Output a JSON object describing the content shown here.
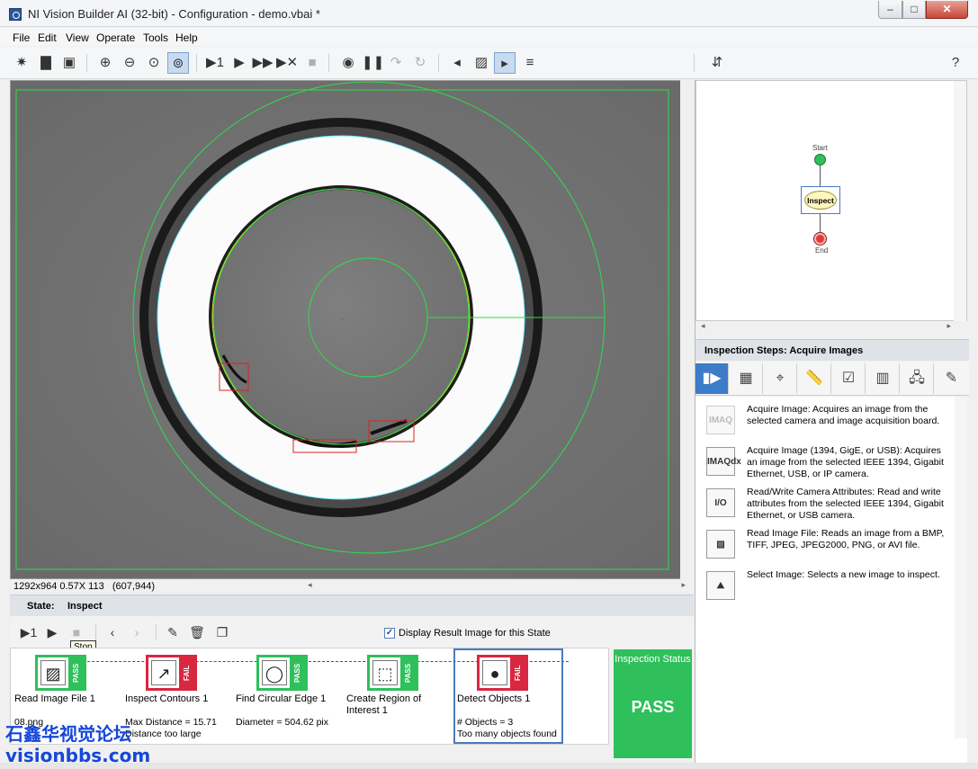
{
  "window": {
    "title": "NI Vision Builder AI (32-bit) - Configuration - demo.vbai *"
  },
  "menu": [
    "File",
    "Edit",
    "View",
    "Operate",
    "Tools",
    "Help"
  ],
  "viewer": {
    "status_info": "1292x964 0.57X 113",
    "cursor_coords": "(607,944)"
  },
  "state": {
    "label": "State:",
    "value": "Inspect"
  },
  "step_toolbar": {
    "tooltip": "Stop",
    "display_result_label": "Display Result Image for this State",
    "display_result_checked": true
  },
  "steps": [
    {
      "name": "Read Image File 1",
      "status": "PASS",
      "result": "08.png",
      "icon": "read-image-icon"
    },
    {
      "name": "Inspect Contours 1",
      "status": "FAIL",
      "result": "Max Distance = 15.71\nDistance too large",
      "icon": "inspect-contours-icon"
    },
    {
      "name": "Find Circular Edge 1",
      "status": "PASS",
      "result": "Diameter = 504.62 pix",
      "icon": "circular-edge-icon"
    },
    {
      "name": "Create Region of Interest 1",
      "status": "PASS",
      "result": "",
      "icon": "roi-icon"
    },
    {
      "name": "Detect Objects 1",
      "status": "FAIL",
      "result": "# Objects = 3\nToo many objects found",
      "icon": "detect-objects-icon"
    }
  ],
  "inspection_status": {
    "label": "Inspection Status",
    "value": "PASS"
  },
  "flowchart": {
    "start": "Start",
    "inspect": "Inspect",
    "end": "End"
  },
  "inspection_steps": {
    "header": "Inspection Steps: Acquire Images",
    "items": [
      {
        "icon_label": "IMAQ",
        "text": "Acquire Image:  Acquires an image from the selected camera and image acquisition board."
      },
      {
        "icon_label": "IMAQdx",
        "text": "Acquire Image (1394, GigE, or USB):  Acquires an image from the selected IEEE 1394, Gigabit Ethernet, USB, or IP camera."
      },
      {
        "icon_label": "I/O",
        "text": "Read/Write Camera Attributes:  Read and write attributes from the selected IEEE 1394, Gigabit Ethernet, or USB camera."
      },
      {
        "icon_label": "",
        "text": "Read Image File:  Reads an image from a BMP, TIFF, JPEG, JPEG2000, PNG, or AVI file."
      },
      {
        "icon_label": "",
        "text": "Select Image:  Selects a new image to inspect."
      }
    ]
  },
  "watermark": {
    "line1": "石鑫华视觉论坛",
    "line2": "visionbbs.com"
  },
  "colors": {
    "pass": "#2fbf5b",
    "fail": "#d9273f",
    "accent": "#3d7cc9"
  }
}
